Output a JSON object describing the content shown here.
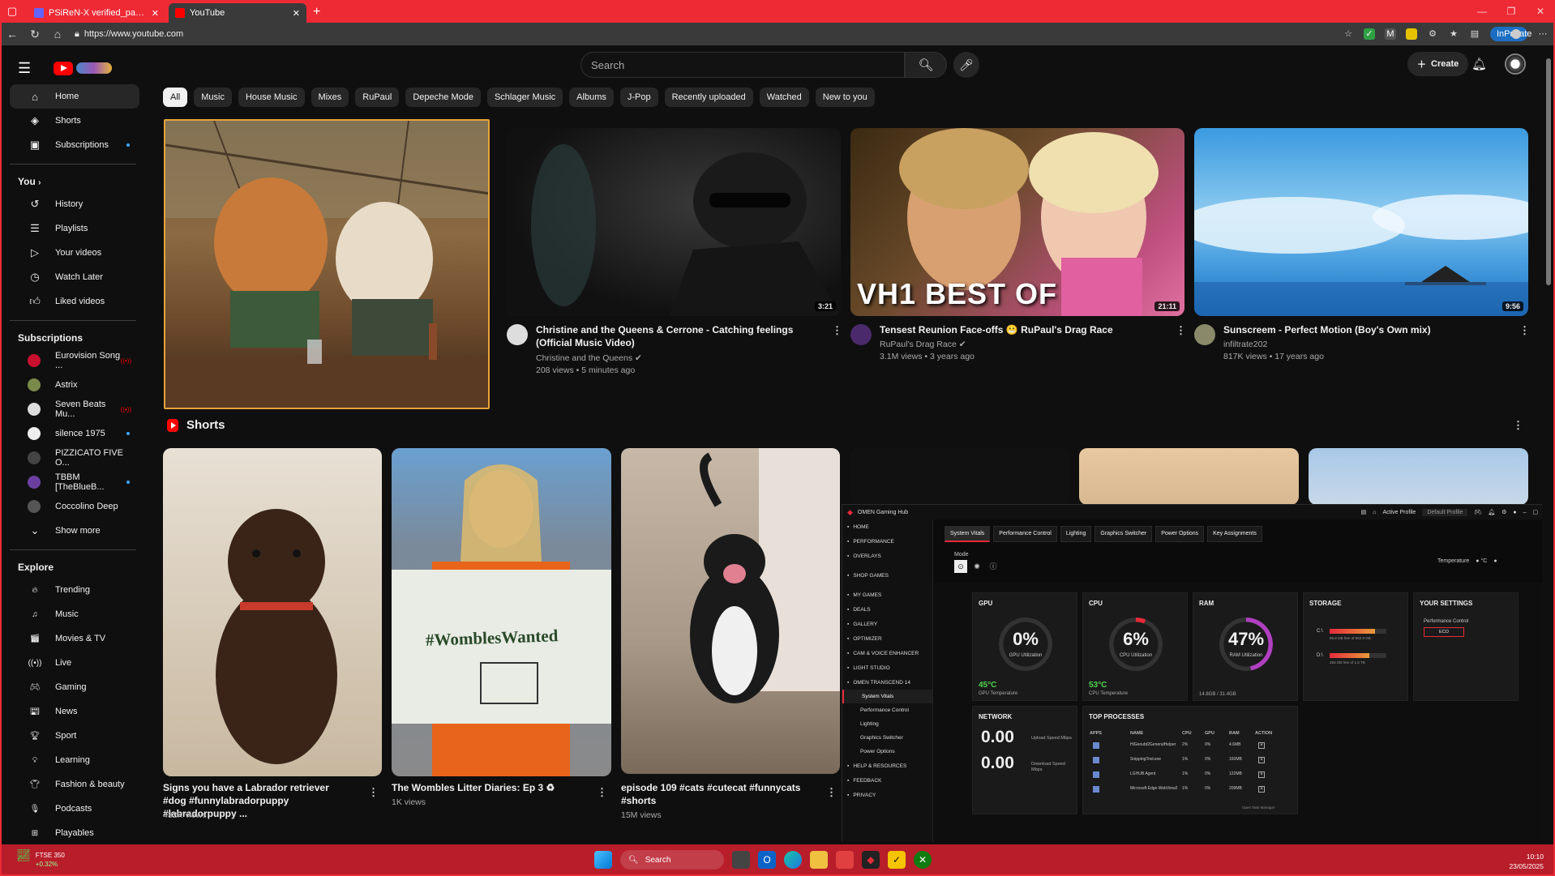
{
  "browser": {
    "tabs": [
      {
        "title": "PSiReN-X verified_paws: \"#Plato..."
      },
      {
        "title": "YouTube"
      }
    ],
    "url": "https://www.youtube.com",
    "inprivate": "InPrivate"
  },
  "header": {
    "search_placeholder": "Search",
    "create_label": "Create"
  },
  "sidebar": {
    "main": [
      {
        "label": "Home",
        "icon": "home-icon"
      },
      {
        "label": "Shorts",
        "icon": "shorts-icon"
      },
      {
        "label": "Subscriptions",
        "icon": "subscriptions-icon"
      }
    ],
    "you_title": "You",
    "you": [
      {
        "label": "History"
      },
      {
        "label": "Playlists"
      },
      {
        "label": "Your videos"
      },
      {
        "label": "Watch Later"
      },
      {
        "label": "Liked videos"
      }
    ],
    "subs_title": "Subscriptions",
    "subs": [
      {
        "label": "Eurovision Song ...",
        "color": "#c8102e",
        "live": true
      },
      {
        "label": "Astrix",
        "color": "#7a8a4a"
      },
      {
        "label": "Seven Beats Mu...",
        "color": "#ddd",
        "live": true
      },
      {
        "label": "silence 1975",
        "color": "#eee",
        "dot": true
      },
      {
        "label": "PIZZICATO FIVE O...",
        "color": "#444"
      },
      {
        "label": "TBBM [TheBlueB...",
        "color": "#6b3fa0",
        "dot": true
      },
      {
        "label": "Coccolino Deep",
        "color": "#555"
      }
    ],
    "show_more": "Show more",
    "explore_title": "Explore",
    "explore": [
      {
        "label": "Trending"
      },
      {
        "label": "Music"
      },
      {
        "label": "Movies & TV"
      },
      {
        "label": "Live"
      },
      {
        "label": "Gaming"
      },
      {
        "label": "News"
      },
      {
        "label": "Sport"
      },
      {
        "label": "Learning"
      },
      {
        "label": "Fashion & beauty"
      },
      {
        "label": "Podcasts"
      },
      {
        "label": "Playables"
      }
    ]
  },
  "chips": [
    "All",
    "Music",
    "House Music",
    "Mixes",
    "RuPaul",
    "Depeche Mode",
    "Schlager Music",
    "Albums",
    "J-Pop",
    "Recently uploaded",
    "Watched",
    "New to you"
  ],
  "videos": [
    {
      "title": "Christine and the Queens & Cerrone - Catching feelings (Official Music Video)",
      "channel": "Christine and the Queens ✔",
      "meta": "208 views • 5 minutes ago",
      "duration": "3:21"
    },
    {
      "title": "Tensest Reunion Face-offs 😬 RuPaul's Drag Race",
      "channel": "RuPaul's Drag Race ✔",
      "meta": "3.1M views • 3 years ago",
      "duration": "21:11",
      "overlay": "VH1 BEST OF"
    },
    {
      "title": "Sunscreem - Perfect Motion (Boy's Own mix)",
      "channel": "infiltrate202",
      "meta": "817K views • 17 years ago",
      "duration": "9:56"
    }
  ],
  "shorts": {
    "title": "Shorts",
    "items": [
      {
        "title": "Signs you have a Labrador retriever #dog #funnylabradorpuppy #labradorpuppy ...",
        "views": "432K views"
      },
      {
        "title": "The Wombles Litter Diaries: Ep 3 ♻",
        "views": "1K views",
        "sign": "#WomblesWanted"
      },
      {
        "title": "episode 109 #cats #cutecat #funnycats #shorts",
        "views": "15M views"
      }
    ]
  },
  "omen": {
    "title": "OMEN Gaming Hub",
    "profile": "Active Profile",
    "profile_value": "Default Profile",
    "nav": [
      "HOME",
      "PERFORMANCE",
      "OVERLAYS",
      "SHOP GAMES",
      "MY GAMES",
      "DEALS",
      "GALLERY",
      "OPTIMIZER",
      "CAM & VOICE ENHANCER",
      "LIGHT STUDIO",
      "OMEN TRANSCEND 14"
    ],
    "subnav": [
      "System Vitals",
      "Performance Control",
      "Lighting",
      "Graphics Switcher",
      "Power Options"
    ],
    "footer_nav": [
      "HELP & RESOURCES",
      "FEEDBACK",
      "PRIVACY"
    ],
    "tabs": [
      "System Vitals",
      "Performance Control",
      "Lighting",
      "Graphics Switcher",
      "Power Options",
      "Key Assignments"
    ],
    "mode_label": "Mode",
    "temp_label": "Temperature",
    "temp_unit": "°C",
    "gpu": {
      "title": "GPU",
      "value": "0%",
      "label": "GPU Utilization",
      "temp": "45°C",
      "temp_label": "GPU Temperature",
      "pct": 0
    },
    "cpu": {
      "title": "CPU",
      "value": "6%",
      "label": "CPU Utilization",
      "temp": "53°C",
      "temp_label": "CPU Temperature",
      "pct": 6
    },
    "ram": {
      "title": "RAM",
      "value": "47%",
      "label": "RAM Utilization",
      "detail": "14.8GB / 31.4GB",
      "pct": 47
    },
    "storage": {
      "title": "STORAGE",
      "drives": [
        {
          "letter": "C:\\",
          "text": "96.8 GB free of 952.9 GB"
        },
        {
          "letter": "D:\\",
          "text": "283 GB free of 1.8 TB"
        }
      ]
    },
    "settings": {
      "title": "YOUR SETTINGS",
      "sub": "Performance Control",
      "value": "ECO"
    },
    "network": {
      "title": "NETWORK",
      "up": "0.00",
      "up_label": "Upload Speed Mbps",
      "down": "0.00",
      "down_label": "Download Speed Mbps"
    },
    "processes": {
      "title": "TOP PROCESSES",
      "headers": [
        "APPS",
        "NAME",
        "CPU",
        "GPU",
        "RAM",
        "ACTION"
      ],
      "rows": [
        [
          "HiGeoubt2GeneralHelper",
          "2%",
          "0%",
          "4.6MB"
        ],
        [
          "SnippingTool.exe",
          "1%",
          "0%",
          "160MB"
        ],
        [
          "LGHUB Agent",
          "1%",
          "0%",
          "122MB"
        ],
        [
          "Microsoft Edge WebView2",
          "1%",
          "0%",
          "209MB"
        ]
      ],
      "footer": "Open Task Manager"
    }
  },
  "taskbar": {
    "stock_name": "FTSE 350",
    "stock_change": "+0.32%",
    "search": "Search",
    "time": "10:10",
    "date": "23/05/2025"
  }
}
